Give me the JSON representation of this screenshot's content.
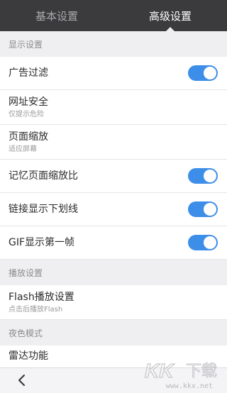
{
  "tabs": [
    {
      "label": "基本设置",
      "active": false
    },
    {
      "label": "高级设置",
      "active": true
    }
  ],
  "sections": {
    "display": {
      "header": "显示设置",
      "rows": [
        {
          "title": "广告过滤",
          "toggle": true
        },
        {
          "title": "网址安全",
          "subtitle": "仅提示危险"
        },
        {
          "title": "页面缩放",
          "subtitle": "适应屏幕"
        },
        {
          "title": "记忆页面缩放比",
          "toggle": true
        },
        {
          "title": "链接显示下划线",
          "toggle": true
        },
        {
          "title": "GIF显示第一帧",
          "toggle": true
        }
      ]
    },
    "playback": {
      "header": "播放设置",
      "rows": [
        {
          "title": "Flash播放设置",
          "subtitle": "点击后播放Flash"
        }
      ]
    },
    "night": {
      "header": "夜色模式",
      "rows": [
        {
          "title": "雷达功能"
        }
      ]
    }
  },
  "watermark": {
    "text": "www.kkx.net",
    "logo": "KK下载"
  },
  "colors": {
    "accent": "#3d8ee8",
    "tabbar": "#3b3b3d",
    "section_bg": "#efeff1"
  },
  "icons": {
    "back": "chevron-left-icon"
  }
}
